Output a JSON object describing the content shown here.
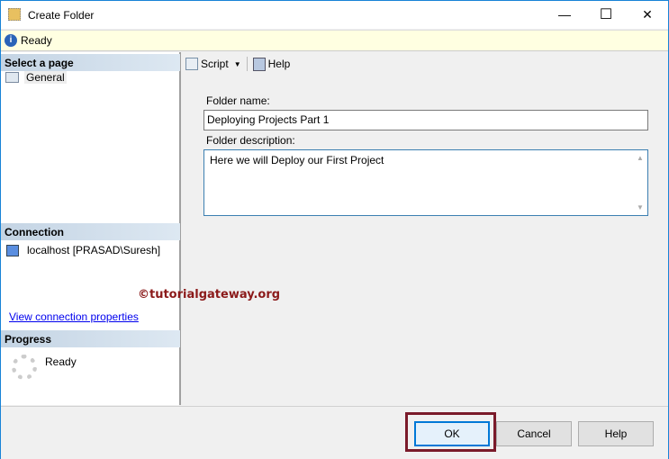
{
  "window": {
    "title": "Create Folder",
    "minimize": "—",
    "maximize": "☐",
    "close": "✕"
  },
  "status": {
    "text": "Ready"
  },
  "sidebar": {
    "select_page": "Select a page",
    "pages": [
      {
        "label": "General"
      }
    ],
    "connection_header": "Connection",
    "connection": "localhost [PRASAD\\Suresh]",
    "view_link": "View connection properties",
    "progress_header": "Progress",
    "progress_text": "Ready"
  },
  "toolbar": {
    "script": "Script",
    "help": "Help"
  },
  "form": {
    "folder_name_label": "Folder name:",
    "folder_name_value": "Deploying Projects Part 1",
    "desc_label": "Folder description:",
    "desc_value": "Here we will Deploy our First Project"
  },
  "watermark": "©tutorialgateway.org",
  "buttons": {
    "ok": "OK",
    "cancel": "Cancel",
    "help": "Help"
  }
}
